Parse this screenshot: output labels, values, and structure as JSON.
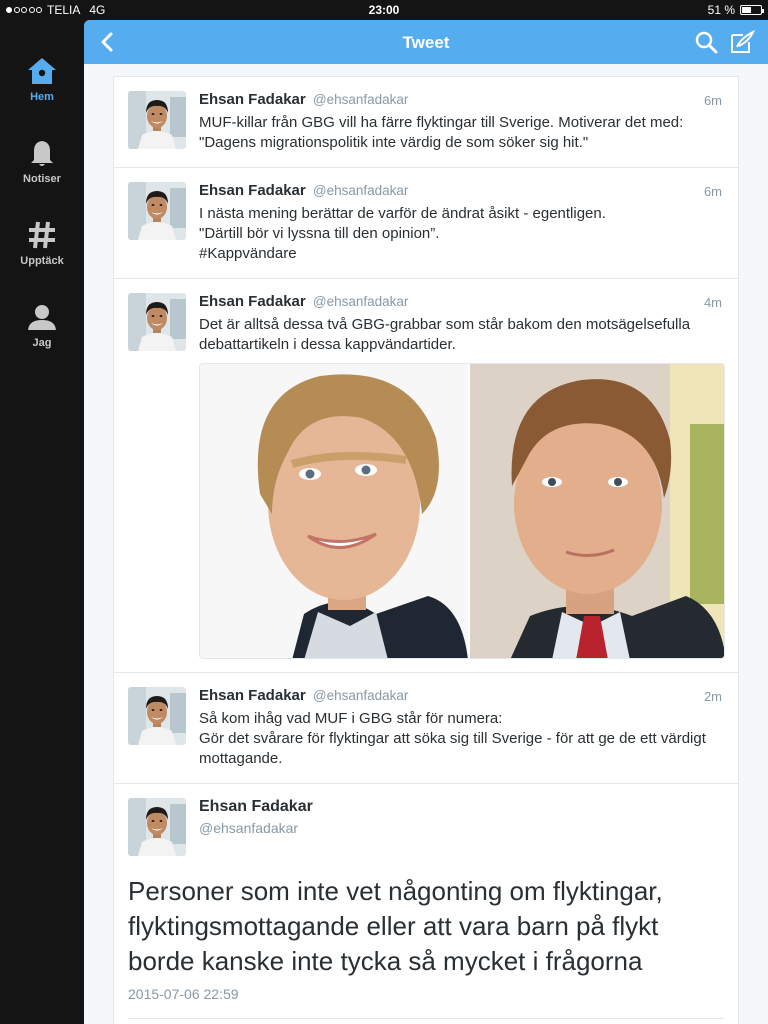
{
  "status_bar": {
    "carrier": "TELIA",
    "network": "4G",
    "time": "23:00",
    "battery": "51 %",
    "battery_level": 0.51,
    "signal_bars_filled": 1,
    "signal_bars_total": 5
  },
  "sidebar": {
    "items": [
      {
        "label": "Hem",
        "icon": "home-icon",
        "active": true
      },
      {
        "label": "Notiser",
        "icon": "bell-icon",
        "active": false
      },
      {
        "label": "Upptäck",
        "icon": "hashtag-icon",
        "active": false
      },
      {
        "label": "Jag",
        "icon": "person-icon",
        "active": false
      }
    ]
  },
  "top_bar": {
    "title": "Tweet",
    "icons": [
      "back-chevron-icon",
      "search-icon",
      "compose-icon"
    ]
  },
  "tweets": [
    {
      "name": "Ehsan Fadakar",
      "handle": "@ehsanfadakar",
      "time": "6m",
      "text": "MUF-killar från GBG vill ha färre flyktingar till Sverige. Motiverar det med:\n\"Dagens migrationspolitik inte värdig de som söker sig hit.\""
    },
    {
      "name": "Ehsan Fadakar",
      "handle": "@ehsanfadakar",
      "time": "6m",
      "text": "I nästa mening berättar de varför de ändrat åsikt - egentligen.\n\"Därtill bör vi lyssna till den opinion”.\n#Kappvändare"
    },
    {
      "name": "Ehsan Fadakar",
      "handle": "@ehsanfadakar",
      "time": "4m",
      "text": "Det är alltså dessa två GBG-grabbar som står bakom den motsägelsefulla debattartikeln i dessa kappvändartider."
    },
    {
      "name": "Ehsan Fadakar",
      "handle": "@ehsanfadakar",
      "time": "2m",
      "text": "Så kom ihåg vad MUF i GBG står för numera:\nGör det svårare för flyktingar att söka sig till Sverige - för att ge de ett värdigt mottagande."
    }
  ],
  "detail": {
    "name": "Ehsan Fadakar",
    "handle": "@ehsanfadakar",
    "text": "Personer som inte vet någonting om flyktingar, flyktingsmottagande eller att vara barn på flykt borde kanske inte tycka så mycket i frågorna",
    "date": "2015-07-06 22:59"
  },
  "colors": {
    "accent": "#55acee",
    "dark_chrome": "#141414",
    "text_primary": "#292f33",
    "text_secondary": "#8899a6",
    "border": "#e1e8ed"
  }
}
